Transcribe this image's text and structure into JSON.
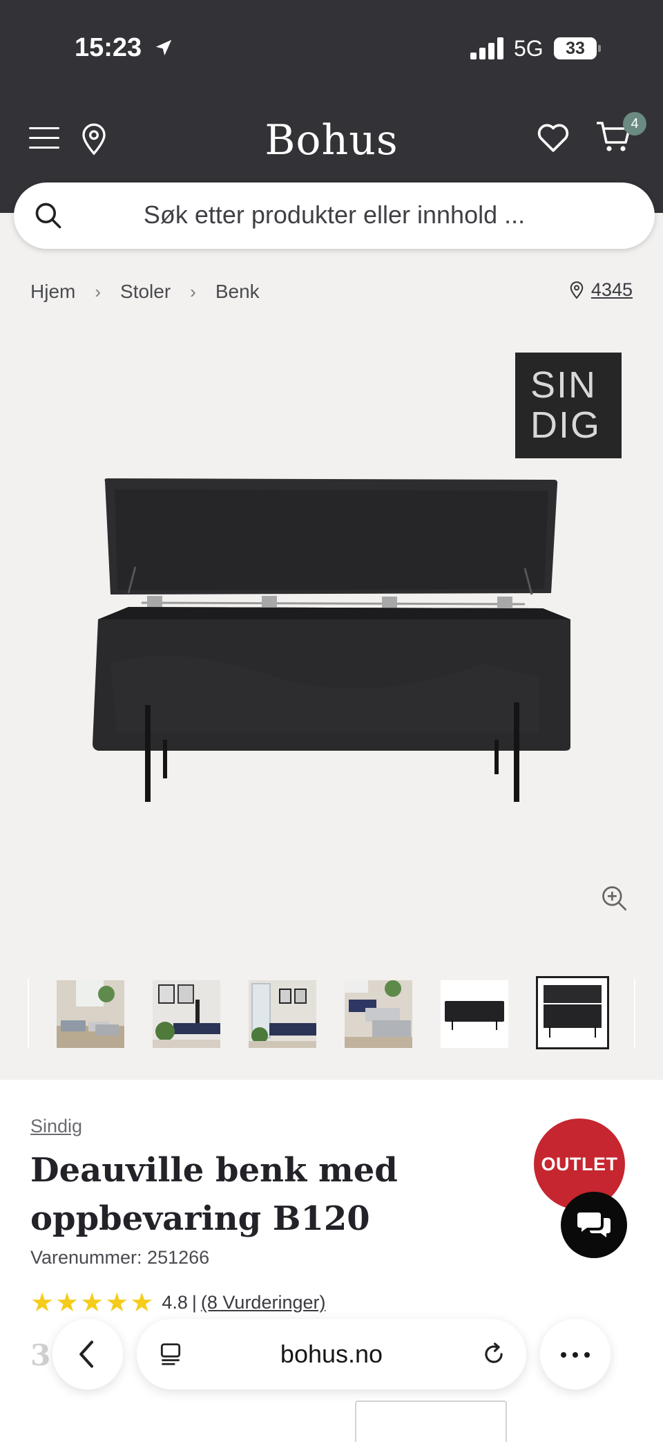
{
  "status_bar": {
    "time": "15:23",
    "network": "5G",
    "battery": "33"
  },
  "header": {
    "logo": "Bohus",
    "cart_count": "4"
  },
  "search": {
    "placeholder": "Søk etter produkter eller innhold ..."
  },
  "breadcrumb": [
    "Hjem",
    "Stoler",
    "Benk"
  ],
  "store": {
    "postal_code": "4345"
  },
  "brand_logo": {
    "text_row1": "SIN",
    "text_row2": "DIG"
  },
  "product": {
    "brand": "Sindig",
    "title": "Deauville benk med oppbevaring B120",
    "sku": "Varenummer: 251266",
    "rating": "4.8",
    "rating_separator": "|",
    "reviews": "(8 Vurderinger)",
    "badge": "OUTLET",
    "price_peek": "3"
  },
  "thumbnails": [
    "lifestyle-bench-grey",
    "lifestyle-bench-navy",
    "lifestyle-bench-window",
    "lifestyle-benches-row",
    "product-bench-closed",
    "product-bench-open"
  ],
  "browser": {
    "url": "bohus.no"
  },
  "colors": {
    "header_bg": "#323237",
    "outlet_red": "#c6262f",
    "star_yellow": "#f5cc1c",
    "cart_badge": "#6a8a82"
  }
}
